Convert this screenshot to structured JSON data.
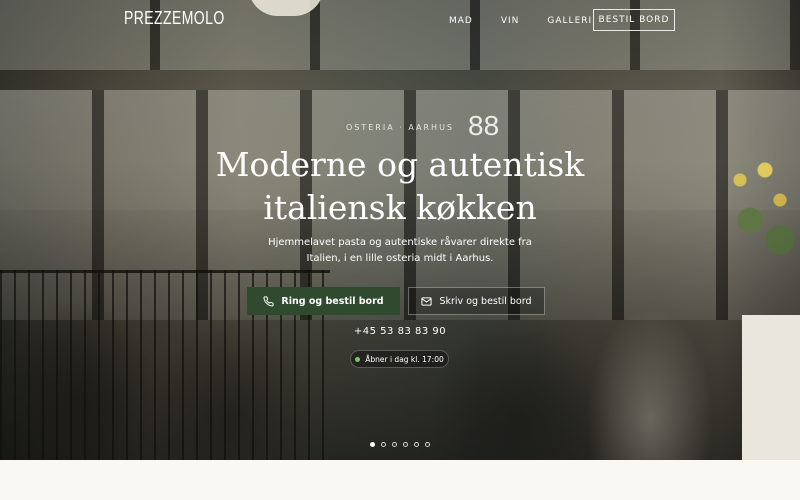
{
  "brand": {
    "logo": "PREZZEMOLO"
  },
  "nav": {
    "links": [
      "MAD",
      "VIN",
      "GALLERI"
    ],
    "cta": "BESTIL BORD"
  },
  "hero": {
    "photo_number": "88",
    "eyebrow": "OSTERIA · AARHUS",
    "headline": "Moderne og autentisk italiensk køkken",
    "subtext": "Hjemmelavet pasta og autentiske råvarer direkte fra Italien, i en lille osteria midt i Aarhus.",
    "primary_button": {
      "label": "Ring og bestil bord",
      "icon": "phone-icon"
    },
    "secondary_button": {
      "label": "Skriv og bestil bord",
      "icon": "mail-icon"
    },
    "phone": "+45 53 83 83 90",
    "open_status": "Åbner i dag kl. 17:00",
    "slides": {
      "count": 6,
      "active": 0
    }
  },
  "colors": {
    "primary_green": "#2f4a2f",
    "status_green": "#7cc46b",
    "page_background": "#faf8f2"
  }
}
